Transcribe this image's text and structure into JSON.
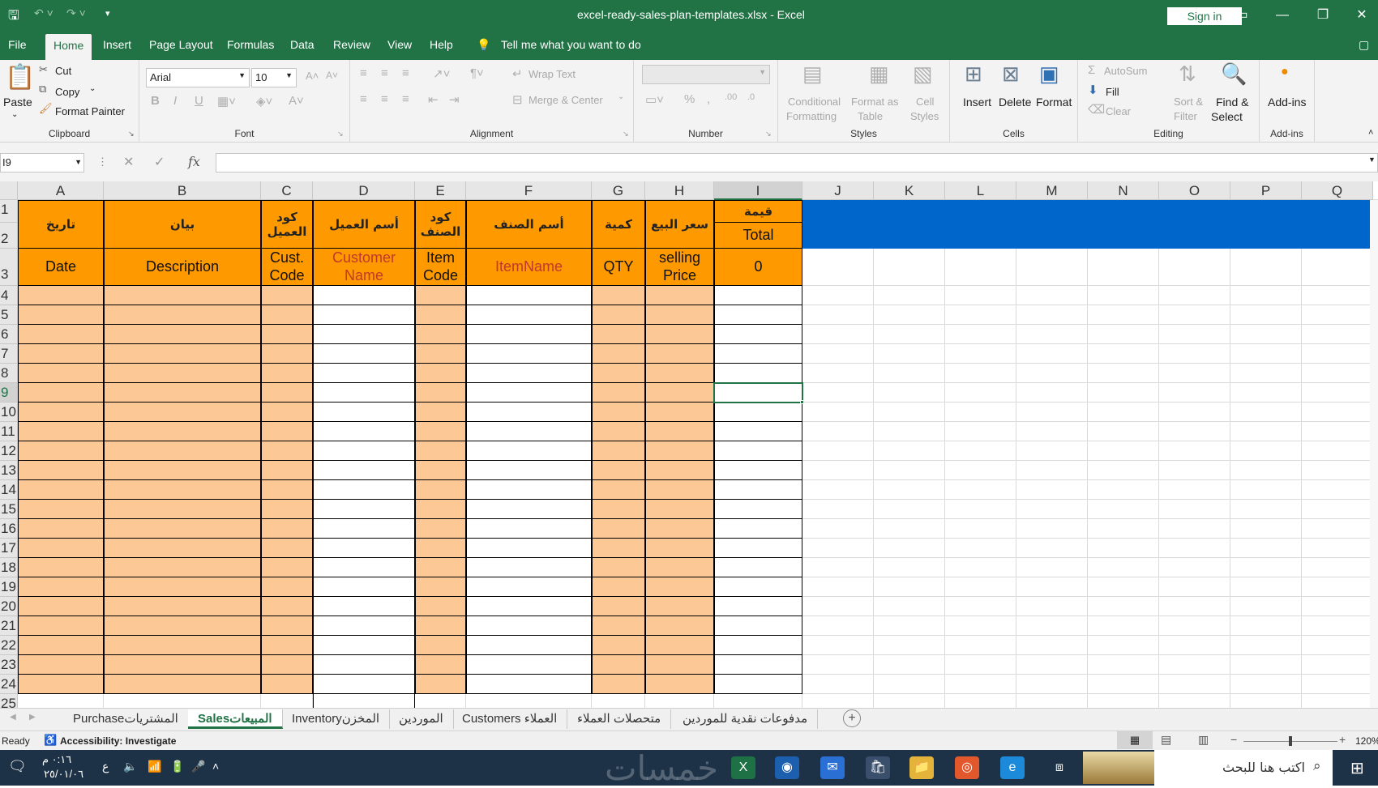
{
  "titlebar": {
    "title": "excel-ready-sales-plan-templates.xlsx  -  Excel",
    "sign_in": "Sign in",
    "qat_save_icon": "save-icon",
    "qat_undo_icon": "undo-icon",
    "qat_redo_icon": "redo-icon"
  },
  "menu": {
    "items": [
      "File",
      "Home",
      "Insert",
      "Page Layout",
      "Formulas",
      "Data",
      "Review",
      "View",
      "Help"
    ],
    "active": "Home",
    "tell_me": "Tell me what you want to do"
  },
  "ribbon": {
    "clipboard": {
      "paste": "Paste",
      "cut": "Cut",
      "copy": "Copy",
      "format_painter": "Format Painter",
      "label": "Clipboard"
    },
    "font": {
      "font_name": "Arial",
      "font_size": "10",
      "bold": "B",
      "italic": "I",
      "underline": "U",
      "label": "Font"
    },
    "alignment": {
      "wrap_text": "Wrap Text",
      "merge_center": "Merge & Center",
      "label": "Alignment"
    },
    "number": {
      "percent": "%",
      "comma": ",",
      "label": "Number"
    },
    "styles": {
      "conditional": "Conditional",
      "conditional2": "Formatting",
      "format_as": "Format as",
      "format_as2": "Table",
      "cell": "Cell",
      "cell2": "Styles",
      "label": "Styles"
    },
    "cells": {
      "insert": "Insert",
      "delete": "Delete",
      "format": "Format",
      "label": "Cells"
    },
    "editing": {
      "autosum": "AutoSum",
      "fill": "Fill",
      "clear": "Clear",
      "sort": "Sort &",
      "sort2": "Filter",
      "find": "Find &",
      "find2": "Select",
      "label": "Editing"
    },
    "addins": {
      "addins": "Add-ins",
      "label": "Add-ins"
    }
  },
  "formula_bar": {
    "name_box": "I9",
    "fx": "fx",
    "value": ""
  },
  "columns": [
    "A",
    "B",
    "C",
    "D",
    "E",
    "F",
    "G",
    "H",
    "I",
    "J",
    "K",
    "L",
    "M",
    "N",
    "O",
    "P",
    "Q"
  ],
  "selected_column": "I",
  "rows": [
    "1",
    "2",
    "3",
    "4",
    "5",
    "6",
    "7",
    "8",
    "9",
    "10",
    "11",
    "12",
    "13",
    "14",
    "15",
    "16",
    "17",
    "18",
    "19",
    "20",
    "21",
    "22",
    "23",
    "24",
    "25"
  ],
  "selected_row": "9",
  "table_headers_ar": [
    "تاريخ",
    "بيان",
    "كود العميل",
    "أسم العميل",
    "كود الصنف",
    "أسم الصنف",
    "كمية",
    "سعر البيع",
    "قيمة"
  ],
  "table_headers_en": [
    "Date",
    "Description",
    "Cust. Code",
    "Customer Name",
    "Item Code",
    "ItemName",
    "QTY",
    "selling Price",
    "0"
  ],
  "total_label": "Total",
  "colors": {
    "header_orange": "#ff9900",
    "light_orange": "#fbc896",
    "blue_band": "#0066cc",
    "excel_green": "#217346"
  },
  "sheet_tabs": [
    "Purchaseالمشتريات",
    "Salesالمبيعات",
    "Inventoryالمخزن",
    "الموردين",
    "Customers العملاء",
    "متحصلات العملاء",
    "مدفوعات نقدية للموردين"
  ],
  "active_sheet": "Salesالمبيعات",
  "status": {
    "ready": "Ready",
    "accessibility": "Accessibility: Investigate",
    "zoom": "120%"
  },
  "taskbar": {
    "time": "٠:١٦ م",
    "date": "٢٥/٠١/٠٦",
    "lang": "ع",
    "search": "اكتب هنا للبحث",
    "watermark": "خمسات"
  }
}
